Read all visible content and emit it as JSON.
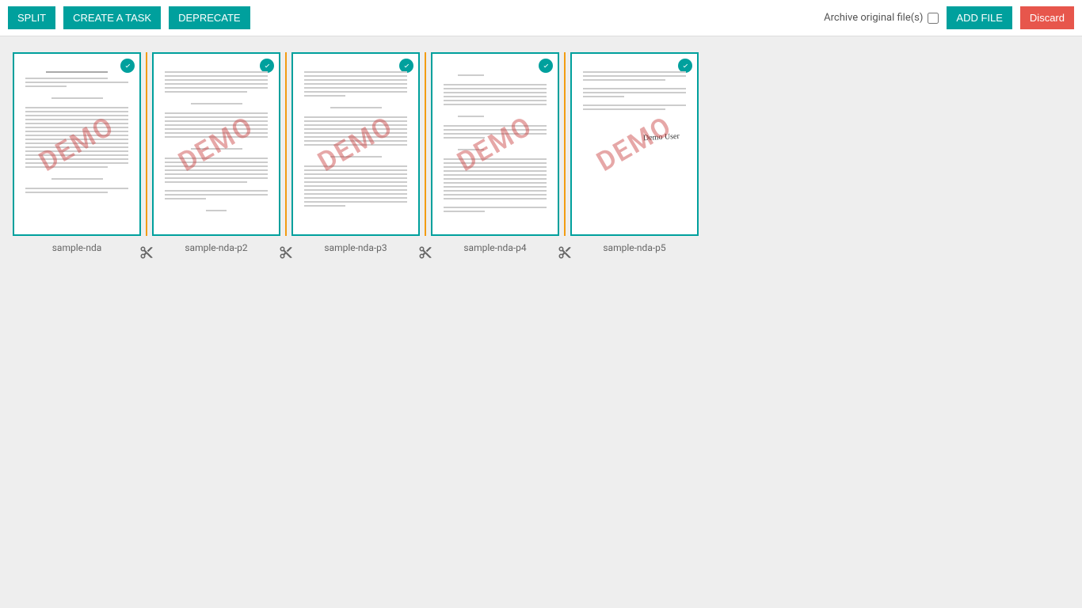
{
  "toolbar": {
    "split": "SPLIT",
    "create_task": "CREATE A TASK",
    "deprecate": "DEPRECATE",
    "archive_label": "Archive original file(s)",
    "add_file": "ADD FILE",
    "discard": "Discard"
  },
  "watermark": "DEMO",
  "pages": [
    {
      "label": "sample-nda"
    },
    {
      "label": "sample-nda-p2"
    },
    {
      "label": "sample-nda-p3"
    },
    {
      "label": "sample-nda-p4"
    },
    {
      "label": "sample-nda-p5"
    }
  ]
}
